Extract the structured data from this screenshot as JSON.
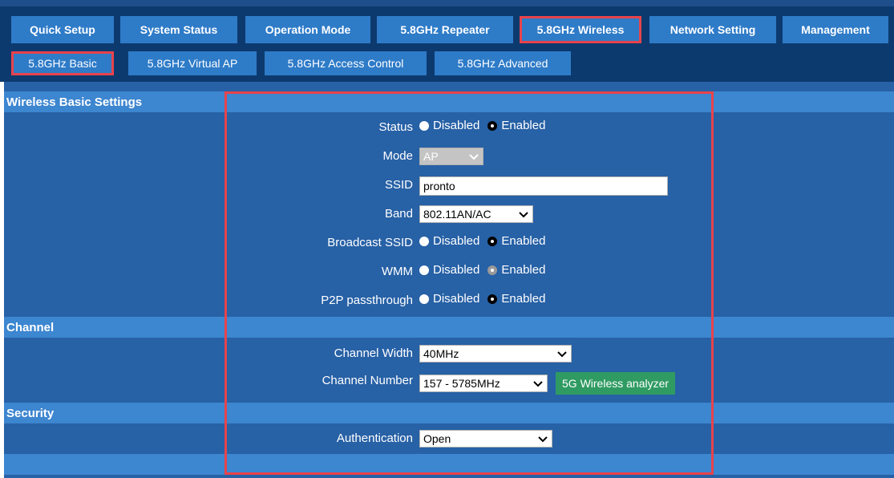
{
  "nav": {
    "tabs": [
      {
        "label": "Quick Setup"
      },
      {
        "label": "System Status"
      },
      {
        "label": "Operation Mode"
      },
      {
        "label": "5.8GHz Repeater"
      },
      {
        "label": "5.8GHz Wireless"
      },
      {
        "label": "Network Setting"
      },
      {
        "label": "Management"
      }
    ],
    "active_tab": "5.8GHz Wireless"
  },
  "subnav": {
    "tabs": [
      {
        "label": "5.8GHz Basic"
      },
      {
        "label": "5.8GHz Virtual AP"
      },
      {
        "label": "5.8GHz Access Control"
      },
      {
        "label": "5.8GHz Advanced"
      }
    ],
    "active_tab": "5.8GHz Basic"
  },
  "sections": {
    "wireless_basic": "Wireless Basic Settings",
    "channel": "Channel",
    "security": "Security"
  },
  "form": {
    "status": {
      "label": "Status",
      "opt1": "Disabled",
      "opt2": "Enabled",
      "selected": "Enabled"
    },
    "mode": {
      "label": "Mode",
      "value": "AP"
    },
    "ssid": {
      "label": "SSID",
      "value": "pronto"
    },
    "band": {
      "label": "Band",
      "value": "802.11AN/AC"
    },
    "broadcast_ssid": {
      "label": "Broadcast SSID",
      "opt1": "Disabled",
      "opt2": "Enabled",
      "selected": "Enabled"
    },
    "wmm": {
      "label": "WMM",
      "opt1": "Disabled",
      "opt2": "Enabled",
      "selected": "Enabled"
    },
    "p2p": {
      "label": "P2P passthrough",
      "opt1": "Disabled",
      "opt2": "Enabled",
      "selected": "Enabled"
    },
    "channel_width": {
      "label": "Channel Width",
      "value": "40MHz"
    },
    "channel_number": {
      "label": "Channel Number",
      "value": "157 - 5785MHz"
    },
    "analyzer_button": "5G Wireless analyzer",
    "authentication": {
      "label": "Authentication",
      "value": "Open"
    }
  },
  "colors": {
    "nav_bg": "#0d3a6e",
    "tab_bg": "#2e7bc8",
    "content_bg": "#2761a6",
    "section_bg": "#3d86d0",
    "highlight": "#e8434b",
    "button_green": "#2f9b62"
  }
}
